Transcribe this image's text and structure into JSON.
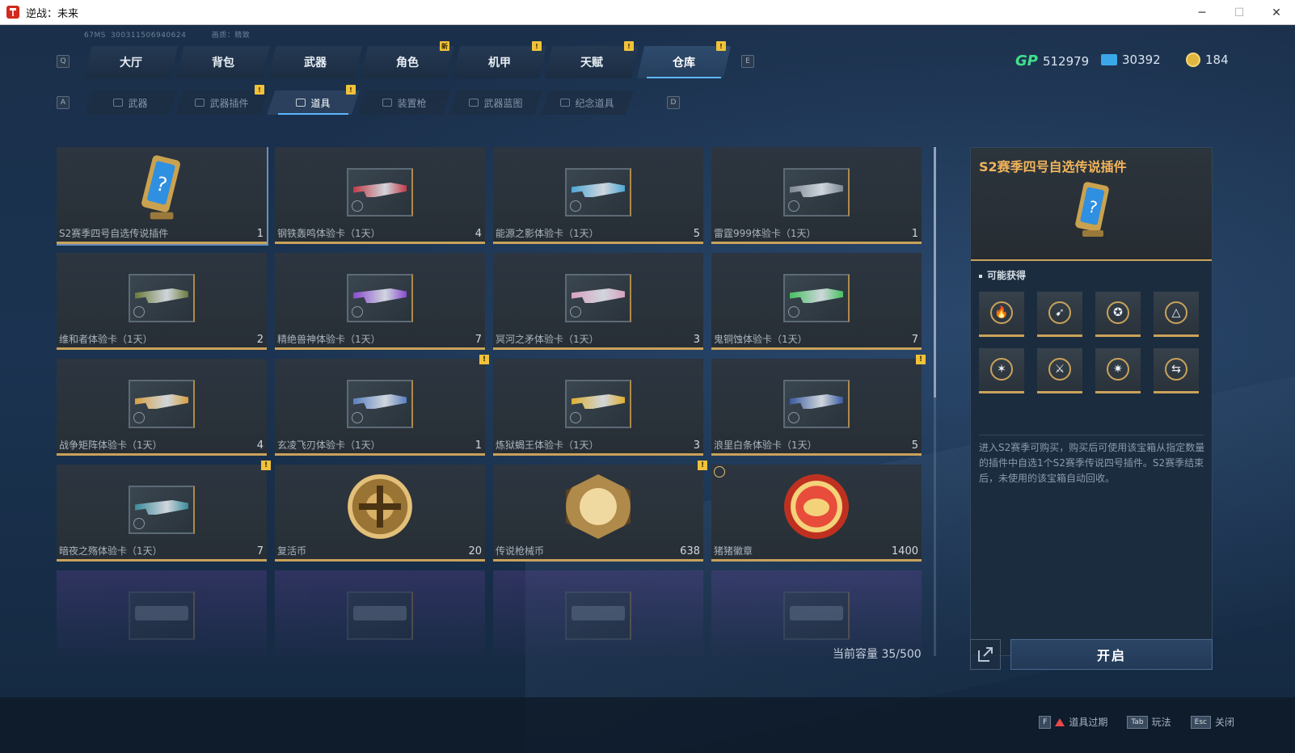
{
  "window": {
    "title": "逆战：未来",
    "minimize": "─",
    "maximize": "☐",
    "close": "✕"
  },
  "status": {
    "ping": "67MS",
    "player_id": "300311506940624",
    "quality": "画质：精致"
  },
  "keys": {
    "prev_main": "Q",
    "next_main": "E",
    "prev_sub": "A",
    "next_sub": "D"
  },
  "main_tabs": [
    {
      "label": "大厅",
      "badge": ""
    },
    {
      "label": "背包",
      "badge": ""
    },
    {
      "label": "武器",
      "badge": ""
    },
    {
      "label": "角色",
      "badge": "新"
    },
    {
      "label": "机甲",
      "badge": "!"
    },
    {
      "label": "天赋",
      "badge": "!"
    },
    {
      "label": "仓库",
      "badge": "!",
      "active": true
    }
  ],
  "sub_tabs": [
    {
      "label": "武器",
      "badge": ""
    },
    {
      "label": "武器插件",
      "badge": "!"
    },
    {
      "label": "道具",
      "badge": "!",
      "active": true
    },
    {
      "label": "装置枪",
      "badge": ""
    },
    {
      "label": "武器蓝图",
      "badge": ""
    },
    {
      "label": "纪念道具",
      "badge": ""
    }
  ],
  "currency": {
    "gp_label": "GP",
    "gp": "512979",
    "ticket": "30392",
    "coin": "184"
  },
  "colors": {
    "accent_gold": "#c9a25a",
    "title_orange": "#f0b45b",
    "badge_yellow": "#f0c23a",
    "active_blue": "#5fb6ff"
  },
  "items": [
    {
      "name": "S2赛季四号自选传说插件",
      "count": "1",
      "kind": "plugin",
      "selected": true,
      "icon": "mystery-card-icon"
    },
    {
      "name": "钢铁轰鸣体验卡（1天）",
      "count": "4",
      "kind": "gun",
      "gun_color": "#c23a48",
      "icon": "gun-icon"
    },
    {
      "name": "能源之影体验卡（1天）",
      "count": "5",
      "kind": "gun",
      "gun_color": "#4fa8d8",
      "icon": "gun-icon"
    },
    {
      "name": "雷霆999体验卡（1天）",
      "count": "1",
      "kind": "gun",
      "gun_color": "#7d8794",
      "icon": "gun-icon"
    },
    {
      "name": "维和者体验卡（1天）",
      "count": "2",
      "kind": "gun",
      "gun_color": "#6a7a3a",
      "icon": "gun-icon"
    },
    {
      "name": "精绝兽神体验卡（1天）",
      "count": "7",
      "kind": "gun",
      "gun_color": "#8a4ad0",
      "icon": "gun-icon"
    },
    {
      "name": "冥河之矛体验卡（1天）",
      "count": "3",
      "kind": "gun",
      "gun_color": "#d8a0c0",
      "icon": "gun-icon"
    },
    {
      "name": "鬼铜蚀体验卡（1天）",
      "count": "7",
      "kind": "gun",
      "gun_color": "#46c060",
      "icon": "gun-icon"
    },
    {
      "name": "战争矩阵体验卡（1天）",
      "count": "4",
      "kind": "gun",
      "gun_color": "#d8a040",
      "icon": "gun-icon"
    },
    {
      "name": "玄凌飞刃体验卡（1天）",
      "count": "1",
      "kind": "gun",
      "gun_color": "#5a7fc0",
      "badge": "!",
      "icon": "blade-icon"
    },
    {
      "name": "炼狱蝎王体验卡（1天）",
      "count": "3",
      "kind": "gun",
      "gun_color": "#e0b030",
      "icon": "gun-icon"
    },
    {
      "name": "浪里白条体验卡（1天）",
      "count": "5",
      "kind": "gun",
      "gun_color": "#3a5aa0",
      "badge": "!",
      "icon": "gun-icon"
    },
    {
      "name": "暗夜之殇体验卡（1天）",
      "count": "7",
      "kind": "gun",
      "gun_color": "#3a8a9a",
      "badge": "!",
      "icon": "gun-icon"
    },
    {
      "name": "复活币",
      "count": "20",
      "kind": "medal",
      "medal": "revive",
      "icon": "revive-coin-icon"
    },
    {
      "name": "传说枪械币",
      "count": "638",
      "kind": "medal",
      "medal": "legend",
      "badge": "!",
      "icon": "legend-gun-coin-icon"
    },
    {
      "name": "猪猪徽章",
      "count": "1400",
      "kind": "medal",
      "medal": "pig",
      "timer": true,
      "icon": "pig-badge-icon"
    }
  ],
  "capacity": "当前容量 35/500",
  "detail": {
    "title": "S2赛季四号自选传说插件",
    "possible_title": "可能获得",
    "rewards": [
      {
        "icon": "flame-plugin-icon",
        "glyph": "🔥"
      },
      {
        "icon": "wing-plugin-icon",
        "glyph": "➹"
      },
      {
        "icon": "star-emblem-plugin-icon",
        "glyph": "✪"
      },
      {
        "icon": "triangle-emblem-plugin-icon",
        "glyph": "△"
      },
      {
        "icon": "burst-plugin-icon",
        "glyph": "✶"
      },
      {
        "icon": "blade-plugin-icon",
        "glyph": "⚔"
      },
      {
        "icon": "spider-plugin-icon",
        "glyph": "✷"
      },
      {
        "icon": "swap-plugin-icon",
        "glyph": "⇆"
      }
    ],
    "description": "进入S2赛季可购买，购买后可使用该宝箱从指定数量的插件中自选1个S2赛季传说四号插件。S2赛季结束后，未使用的该宝箱自动回收。",
    "open_label": "开启"
  },
  "footer": {
    "hints": [
      {
        "key": "F",
        "label": "道具过期",
        "warn": true
      },
      {
        "key": "Tab",
        "label": "玩法"
      },
      {
        "key": "Esc",
        "label": "关闭"
      }
    ]
  }
}
